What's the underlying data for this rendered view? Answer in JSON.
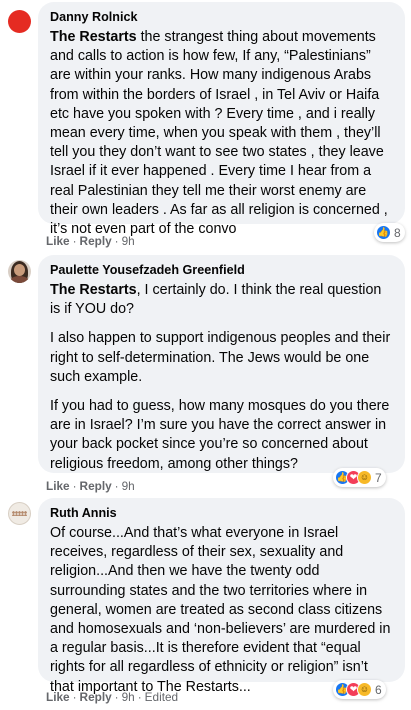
{
  "colors": {
    "like_blue": "#1877f2",
    "love_red": "#f33e58",
    "bubble_bg": "#f0f2f5",
    "meta_gray": "#65676b"
  },
  "comments": [
    {
      "author": "Danny Rolnick",
      "mention": "The Restarts",
      "paragraphs": [
        " the strangest thing about movements and calls to action is how few, If any, “Palestinians” are within your ranks. How many indigenous Arabs from within the borders of Israel , in Tel Aviv or Haifa etc have you spoken with ? Every time , and i really mean every time, when you speak with them , they’ll tell you they don’t want to see two states , they leave Israel if it ever happened . Every time I hear from a real Palestinian they tell me their worst enemy are their own leaders . As far as all religion is concerned , it’s not even part of the convo"
      ],
      "actions": {
        "like": "Like",
        "reply": "Reply",
        "time": "9h"
      },
      "reaction_count": "8",
      "reaction_icons": [
        "like-icon"
      ]
    },
    {
      "author": "Paulette Yousefzadeh Greenfield",
      "mention": "The Restarts",
      "paragraphs": [
        ", I certainly do. I think the real question is if YOU do?",
        "I also happen to support indigenous peoples and their right to self-determination. The Jews would be one such example.",
        "If you had to guess, how many mosques do you there are in Israel? I’m sure you have the correct answer in your back pocket since you’re so concerned about religious freedom, among other things?"
      ],
      "actions": {
        "like": "Like",
        "reply": "Reply",
        "time": "9h"
      },
      "reaction_count": "7",
      "reaction_icons": [
        "like-icon",
        "love-icon"
      ]
    },
    {
      "author": "Ruth Annis",
      "paragraphs": [
        "Of course...And that’s what everyone in Israel receives, regardless of their sex, sexuality and religion...And then we have the twenty odd surrounding states and the two territories where in general, women are treated as second class citizens and homosexuals and ‘non-believers’ are murdered in a regular basis...It is therefore evident that “equal rights for all regardless of ethnicity or religion” isn’t that important to The Restarts..."
      ],
      "actions": {
        "like": "Like",
        "reply": "Reply",
        "time": "9h",
        "edited": "Edited"
      },
      "reaction_count": "6",
      "reaction_icons": [
        "like-icon",
        "love-icon"
      ]
    }
  ]
}
